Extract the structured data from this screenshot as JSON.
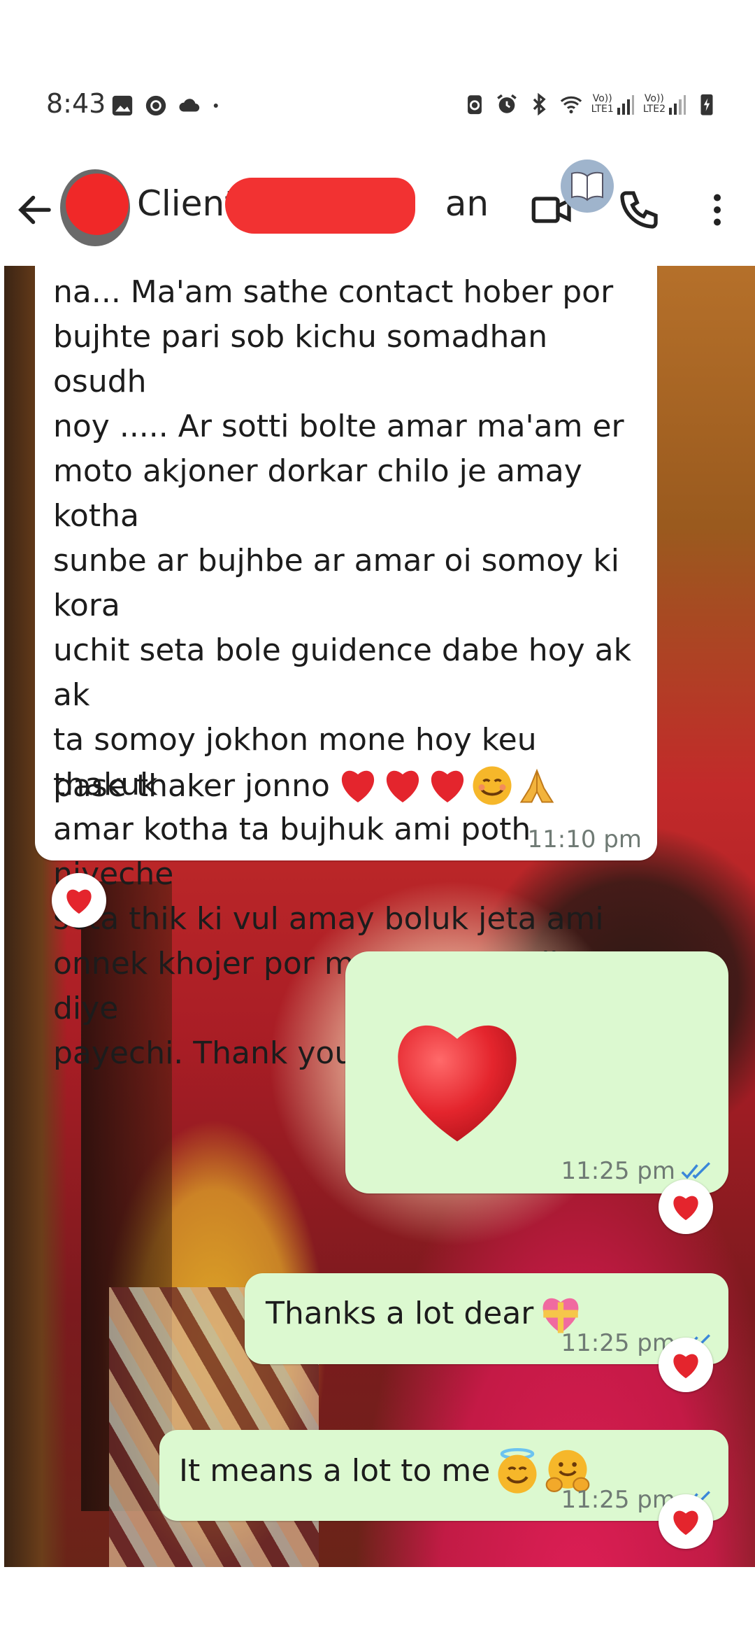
{
  "status_bar": {
    "time": "8:43",
    "left_icons": [
      "gallery-icon",
      "record-icon",
      "cloud-icon",
      "dot-icon"
    ],
    "right_icons": [
      "recycle-icon",
      "alarm-icon",
      "bluetooth-icon",
      "wifi-icon",
      "lte1-signal-icon",
      "lte2-signal-icon",
      "battery-charging-icon"
    ],
    "sim1_label_top": "Vo))",
    "sim1_label_bottom": "LTE1",
    "sim2_label_top": "Vo))",
    "sim2_label_bottom": "LTE2"
  },
  "header": {
    "contact_name_visible_start": "Client",
    "contact_name_visible_end": "an",
    "icons": [
      "back-arrow-icon",
      "video-call-icon",
      "book-icon",
      "voice-call-icon",
      "more-options-icon"
    ]
  },
  "messages": [
    {
      "direction": "incoming",
      "text": "na... Ma'am sathe contact hober por\nbujhte pari sob kichu somadhan osudh\nnoy ..... Ar sotti bolte amar ma'am er\nmoto akjoner dorkar chilo je amay kotha\nsunbe ar bujhbe ar amar oi somoy ki kora\nuchit seta bole guidence dabe hoy ak ak\nta somoy jokhon mone hoy keu thakuk\namar kotha ta bujhuk ami poth niyeche\nseta thik ki vul amay boluk jeta ami\nonnek khojer por ma'am er modhe diye\npayechi. Thank you Dipa ma'am amar",
      "last_line": "pase thaker jonno ",
      "emoji": "❤️❤️❤️😊🙏",
      "time": "11:10 pm",
      "reaction": "❤️"
    },
    {
      "direction": "outgoing",
      "emoji_only": "❤️",
      "time": "11:25 pm",
      "reaction": "❤️"
    },
    {
      "direction": "outgoing",
      "text": "Thanks a lot dear ",
      "emoji": "💝",
      "time": "11:25 pm",
      "reaction": "❤️"
    },
    {
      "direction": "outgoing",
      "text": "It means a lot to me",
      "emoji": "😇🤗",
      "time": "11:25 pm",
      "reaction": "❤️"
    }
  ],
  "colors": {
    "incoming_bubble": "#ffffff",
    "outgoing_bubble": "#dcf9d0",
    "read_ticks": "#3b87d9",
    "heart": "#e4252d",
    "redaction": "#f02828"
  }
}
